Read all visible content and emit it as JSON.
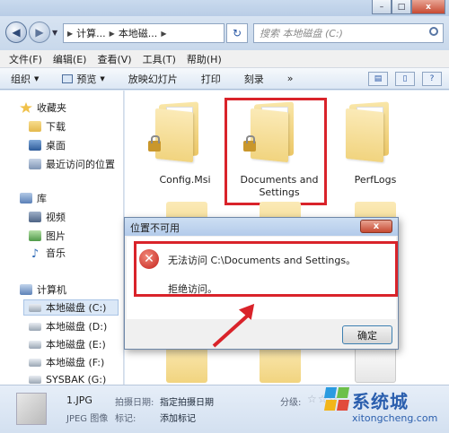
{
  "address": {
    "segments": [
      "计算...",
      "本地磁...",
      ""
    ],
    "search_placeholder": "搜索 本地磁盘 (C:)"
  },
  "menubar": [
    "文件(F)",
    "编辑(E)",
    "查看(V)",
    "工具(T)",
    "帮助(H)"
  ],
  "toolbar": {
    "organize": "组织",
    "preview": "预览",
    "slideshow": "放映幻灯片",
    "print": "打印",
    "burn": "刻录",
    "more": "»"
  },
  "nav": {
    "favorites": "收藏夹",
    "downloads": "下载",
    "desktop": "桌面",
    "recent": "最近访问的位置",
    "libraries": "库",
    "videos": "视频",
    "pictures": "图片",
    "music": "音乐",
    "computer": "计算机",
    "drives": [
      "本地磁盘 (C:)",
      "本地磁盘 (D:)",
      "本地磁盘 (E:)",
      "本地磁盘 (F:)",
      "SYSBAK (G:)"
    ]
  },
  "folders": {
    "config": "Config.Msi",
    "documents_line1": "Documents and",
    "documents_line2": "Settings",
    "perflogs": "PerfLogs"
  },
  "dialog": {
    "title": "位置不可用",
    "message": "无法访问 C:\\Documents and Settings。",
    "detail": "拒绝访问。",
    "ok": "确定",
    "close": "x"
  },
  "details": {
    "filename": "1.JPG",
    "filetype": "JPEG 图像",
    "date_key": "拍摄日期:",
    "date_value": "指定拍摄日期",
    "tag_key": "标记:",
    "tag_value": "添加标记",
    "rating_key": "分级:",
    "rating_stars": "☆☆☆"
  },
  "watermark": {
    "brand": "系统城",
    "url": "xitongcheng.com"
  },
  "colors": {
    "highlight_red": "#d9232a",
    "chrome_blue": "#dbe6f3"
  }
}
